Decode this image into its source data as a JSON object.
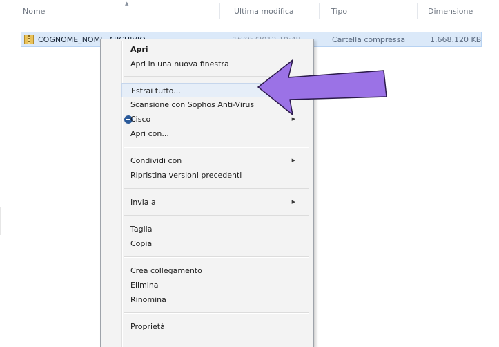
{
  "columns": {
    "name": "Nome",
    "modified": "Ultima modifica",
    "type": "Tipo",
    "size": "Dimensione"
  },
  "file": {
    "name": "COGNOME_NOME_ARCHIVIO",
    "modified": "16/05/2012 10:48",
    "type": "Cartella compressa",
    "size": "1.668.120 KB",
    "icon": "zip-folder-icon"
  },
  "context_menu": {
    "items": [
      {
        "label": "Apri"
      },
      {
        "label": "Apri in una nuova finestra"
      },
      {
        "label": "Estrai tutto..."
      },
      {
        "label": "Scansione con Sophos Anti-Virus"
      },
      {
        "label": "Cisco",
        "icon": "cisco-icon"
      },
      {
        "label": "Apri con..."
      },
      {
        "label": "Condividi con"
      },
      {
        "label": "Ripristina versioni precedenti"
      },
      {
        "label": "Invia a"
      },
      {
        "label": "Taglia"
      },
      {
        "label": "Copia"
      },
      {
        "label": "Crea collegamento"
      },
      {
        "label": "Elimina"
      },
      {
        "label": "Rinomina"
      },
      {
        "label": "Proprietà"
      }
    ],
    "submenu_arrow": "▶",
    "highlight_color": "#e6eef8"
  },
  "annotation": {
    "arrow_color": "#9b72e6",
    "arrow_stroke": "#2b1a4a"
  }
}
